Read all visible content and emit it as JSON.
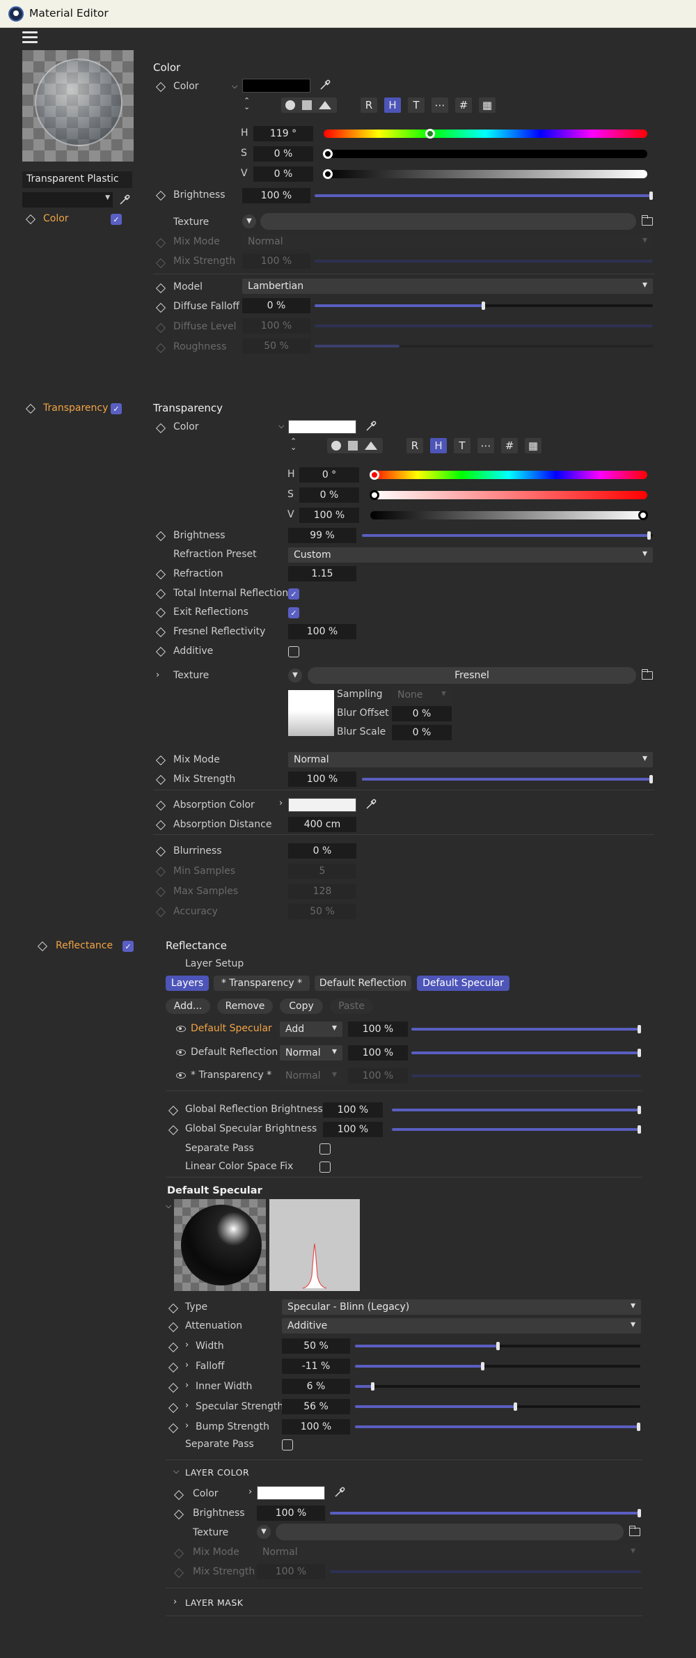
{
  "window": {
    "title": "Material Editor"
  },
  "left": {
    "material_name": "Transparent Plastic",
    "channels": [
      {
        "label": "Color",
        "active": true,
        "checked": true
      },
      {
        "label": "Transparency",
        "active": false,
        "checked": true
      },
      {
        "label": "Reflectance",
        "active": false,
        "checked": true
      }
    ]
  },
  "color": {
    "heading": "Color",
    "color_label": "Color",
    "color_swatch": "#000000",
    "mode_buttons": [
      "R",
      "H",
      "T",
      "⋯",
      "#",
      "▦"
    ],
    "h_label": "H",
    "h": "119 °",
    "s_label": "S",
    "s": "0 %",
    "v_label": "V",
    "v": "0 %",
    "brightness_label": "Brightness",
    "brightness": "100 %",
    "brightness_fraction": 1.0,
    "texture_label": "Texture",
    "mixmode_label": "Mix Mode",
    "mixmode": "Normal",
    "mixstrength_label": "Mix Strength",
    "mixstrength": "100 %",
    "model_label": "Model",
    "model": "Lambertian",
    "diffuse_falloff_label": "Diffuse Falloff",
    "diffuse_falloff": "0 %",
    "diffuse_falloff_fraction": 0.5,
    "diffuse_level_label": "Diffuse Level",
    "diffuse_level": "100 %",
    "roughness_label": "Roughness",
    "roughness": "50 %"
  },
  "transparency": {
    "heading": "Transparency",
    "color_label": "Color",
    "color_swatch": "#ffffff",
    "h_label": "H",
    "h": "0 °",
    "s_label": "S",
    "s": "0 %",
    "v_label": "V",
    "v": "100 %",
    "brightness_label": "Brightness",
    "brightness": "99 %",
    "brightness_fraction": 0.99,
    "refraction_preset_label": "Refraction Preset",
    "refraction_preset": "Custom",
    "refraction_label": "Refraction",
    "refraction": "1.15",
    "tir_label": "Total Internal Reflection",
    "exit_label": "Exit Reflections",
    "fresnel_label": "Fresnel Reflectivity",
    "fresnel": "100 %",
    "additive_label": "Additive",
    "texture_label": "Texture",
    "texture": "Fresnel",
    "sampling_label": "Sampling",
    "sampling": "None",
    "blur_offset_label": "Blur Offset",
    "blur_offset": "0 %",
    "blur_scale_label": "Blur Scale",
    "blur_scale": "0 %",
    "mixmode_label": "Mix Mode",
    "mixmode": "Normal",
    "mixstrength_label": "Mix Strength",
    "mixstrength": "100 %",
    "absorption_color_label": "Absorption Color",
    "absorption_color": "#f2f2f2",
    "absorption_distance_label": "Absorption Distance",
    "absorption_distance": "400 cm",
    "blurriness_label": "Blurriness",
    "blurriness": "0 %",
    "min_samples_label": "Min Samples",
    "min_samples": "5",
    "max_samples_label": "Max Samples",
    "max_samples": "128",
    "accuracy_label": "Accuracy",
    "accuracy": "50 %"
  },
  "reflectance": {
    "heading": "Reflectance",
    "layer_setup": "Layer Setup",
    "tabs": [
      "Layers",
      "* Transparency *",
      "Default Reflection",
      "Default Specular"
    ],
    "actions": [
      "Add...",
      "Remove",
      "Copy",
      "Paste"
    ],
    "layers": [
      {
        "name": "Default Specular",
        "mode": "Add",
        "value": "100 %"
      },
      {
        "name": "Default Reflection",
        "mode": "Normal",
        "value": "100 %"
      },
      {
        "name": "* Transparency *",
        "mode": "Normal",
        "value": "100 %"
      }
    ],
    "global_reflection_label": "Global Reflection Brightness",
    "global_reflection": "100 %",
    "global_specular_label": "Global Specular Brightness",
    "global_specular": "100 %",
    "separate_pass_label": "Separate Pass",
    "linear_fix_label": "Linear Color Space Fix",
    "layer_heading": "Default Specular",
    "type_label": "Type",
    "type": "Specular - Blinn (Legacy)",
    "attenuation_label": "Attenuation",
    "attenuation": "Additive",
    "width_label": "Width",
    "width": "50 %",
    "width_fraction": 0.5,
    "falloff_label": "Falloff",
    "falloff": "-11 %",
    "falloff_fraction": 0.45,
    "inner_width_label": "Inner Width",
    "inner_width": "6 %",
    "inner_width_fraction": 0.06,
    "specular_strength_label": "Specular Strength",
    "specular_strength": "56 %",
    "specular_strength_fraction": 0.56,
    "bump_strength_label": "Bump Strength",
    "bump_strength": "100 %",
    "bump_strength_fraction": 1.0,
    "layer_separate_pass_label": "Separate Pass",
    "layer_color_heading": "LAYER COLOR",
    "lc_color_label": "Color",
    "lc_color": "#ffffff",
    "lc_brightness_label": "Brightness",
    "lc_brightness": "100 %",
    "lc_texture_label": "Texture",
    "lc_mixmode_label": "Mix Mode",
    "lc_mixmode": "Normal",
    "lc_mixstrength_label": "Mix Strength",
    "lc_mixstrength": "100 %",
    "layer_mask_heading": "LAYER MASK"
  }
}
